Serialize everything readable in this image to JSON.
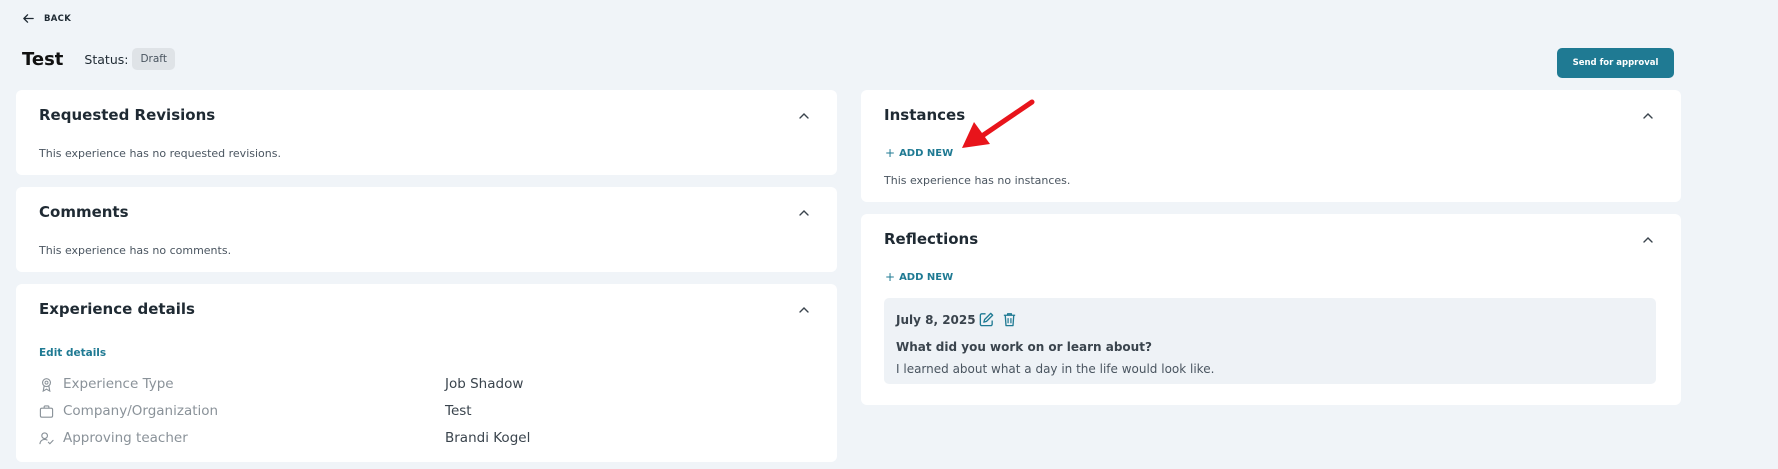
{
  "nav": {
    "back_label": "BACK"
  },
  "header": {
    "title": "Test",
    "status_label": "Status:",
    "status_value": "Draft",
    "approve_button": "Send for approval"
  },
  "requested_revisions": {
    "title": "Requested Revisions",
    "empty_text": "This experience has no requested revisions."
  },
  "comments": {
    "title": "Comments",
    "empty_text": "This experience has no comments."
  },
  "experience_details": {
    "title": "Experience details",
    "edit_label": "Edit details",
    "rows": [
      {
        "icon": "badge-icon",
        "label": "Experience Type",
        "value": "Job Shadow"
      },
      {
        "icon": "briefcase-icon",
        "label": "Company/Organization",
        "value": "Test"
      },
      {
        "icon": "user-check-icon",
        "label": "Approving teacher",
        "value": "Brandi Kogel"
      }
    ]
  },
  "instances": {
    "title": "Instances",
    "add_label": "ADD NEW",
    "empty_text": "This experience has no instances."
  },
  "reflections": {
    "title": "Reflections",
    "add_label": "ADD NEW",
    "items": [
      {
        "date": "July 8, 2025",
        "question": "What did you work on or learn about?",
        "answer": "I learned about what a day in the life would look like."
      }
    ]
  },
  "colors": {
    "background": "#f0f4f8",
    "accent": "#1f7a93",
    "annotation_arrow": "#e8141b"
  }
}
